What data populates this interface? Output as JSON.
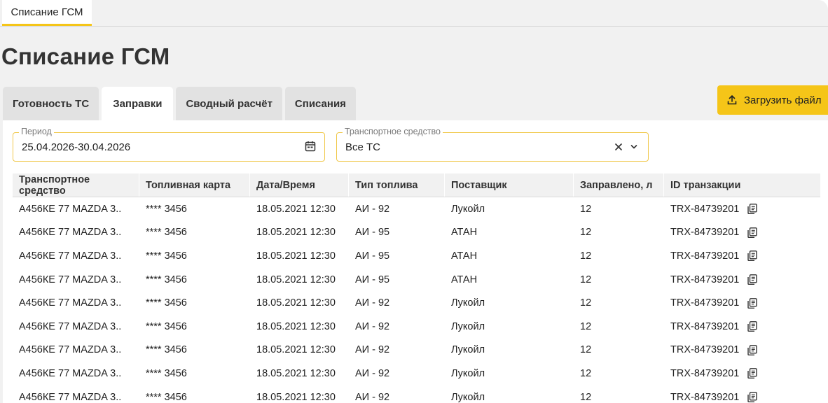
{
  "top_tab": {
    "label": "Списание ГСМ"
  },
  "page": {
    "title": "Списание ГСМ"
  },
  "tabs": [
    {
      "label": "Готовность ТС",
      "active": false
    },
    {
      "label": "Заправки",
      "active": true
    },
    {
      "label": "Сводный расчёт",
      "active": false
    },
    {
      "label": "Списания",
      "active": false
    }
  ],
  "upload": {
    "label": "Загрузить файл"
  },
  "filters": {
    "period": {
      "label": "Период",
      "value": "25.04.2026-30.04.2026"
    },
    "vehicle": {
      "label": "Транспортное средство",
      "value": "Все ТС"
    }
  },
  "table": {
    "headers": [
      "Транспортное средство",
      "Топливная карта",
      "Дата/Время",
      "Тип топлива",
      "Поставщик",
      "Заправлено, л",
      "ID транзакции"
    ],
    "rows": [
      [
        "А456КЕ 77 MAZDA 3..",
        "**** 3456",
        "18.05.2021 12:30",
        "АИ - 92",
        "Лукойл",
        "12",
        "TRX-84739201"
      ],
      [
        "А456КЕ 77 MAZDA 3..",
        "**** 3456",
        "18.05.2021 12:30",
        "АИ - 95",
        "АТАН",
        "12",
        "TRX-84739201"
      ],
      [
        "А456КЕ 77 MAZDA 3..",
        "**** 3456",
        "18.05.2021 12:30",
        "АИ - 95",
        "АТАН",
        "12",
        "TRX-84739201"
      ],
      [
        "А456КЕ 77 MAZDA 3..",
        "**** 3456",
        "18.05.2021 12:30",
        "АИ - 95",
        "АТАН",
        "12",
        "TRX-84739201"
      ],
      [
        "А456КЕ 77 MAZDA 3..",
        "**** 3456",
        "18.05.2021 12:30",
        "АИ - 92",
        "Лукойл",
        "12",
        "TRX-84739201"
      ],
      [
        "А456КЕ 77 MAZDA 3..",
        "**** 3456",
        "18.05.2021 12:30",
        "АИ - 92",
        "Лукойл",
        "12",
        "TRX-84739201"
      ],
      [
        "А456КЕ 77 MAZDA 3..",
        "**** 3456",
        "18.05.2021 12:30",
        "АИ - 92",
        "Лукойл",
        "12",
        "TRX-84739201"
      ],
      [
        "А456КЕ 77 MAZDA 3..",
        "**** 3456",
        "18.05.2021 12:30",
        "АИ - 92",
        "Лукойл",
        "12",
        "TRX-84739201"
      ],
      [
        "А456КЕ 77 MAZDA 3..",
        "**** 3456",
        "18.05.2021 12:30",
        "АИ - 92",
        "Лукойл",
        "12",
        "TRX-84739201"
      ]
    ]
  },
  "colors": {
    "accent": "#f5c518",
    "tab_bg": "#e2e2e2",
    "page_bg": "#f1f1f1"
  },
  "icons": {
    "upload": "upload-icon",
    "calendar": "calendar-icon",
    "clear": "close-icon",
    "dropdown": "chevron-down-icon",
    "copy": "copy-icon"
  }
}
